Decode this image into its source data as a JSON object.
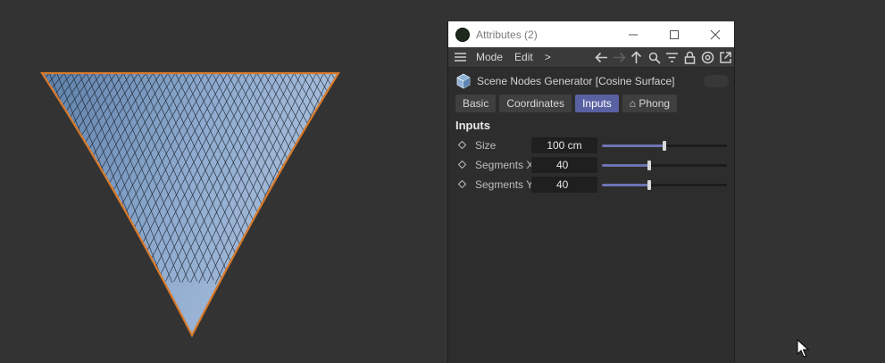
{
  "window": {
    "title": "Attributes (2)"
  },
  "menubar": {
    "items": [
      "Mode",
      "Edit"
    ],
    "more_label": ">"
  },
  "object": {
    "title": "Scene Nodes Generator [Cosine Surface]"
  },
  "tabs": [
    {
      "label": "Basic",
      "active": false
    },
    {
      "label": "Coordinates",
      "active": false
    },
    {
      "label": "Inputs",
      "active": true
    },
    {
      "label": "⌂ Phong",
      "active": false
    }
  ],
  "section": {
    "title": "Inputs"
  },
  "params": [
    {
      "label": "Size",
      "value": "100 cm",
      "slider_fraction": 0.5
    },
    {
      "label": "Segments X",
      "value": "40",
      "slider_fraction": 0.38
    },
    {
      "label": "Segments Y",
      "value": "40",
      "slider_fraction": 0.38
    }
  ],
  "colors": {
    "viewport_bg": "#333333",
    "surface": "#7f9ec4",
    "outline": "#d87a2a",
    "accent": "#5a61a3"
  }
}
